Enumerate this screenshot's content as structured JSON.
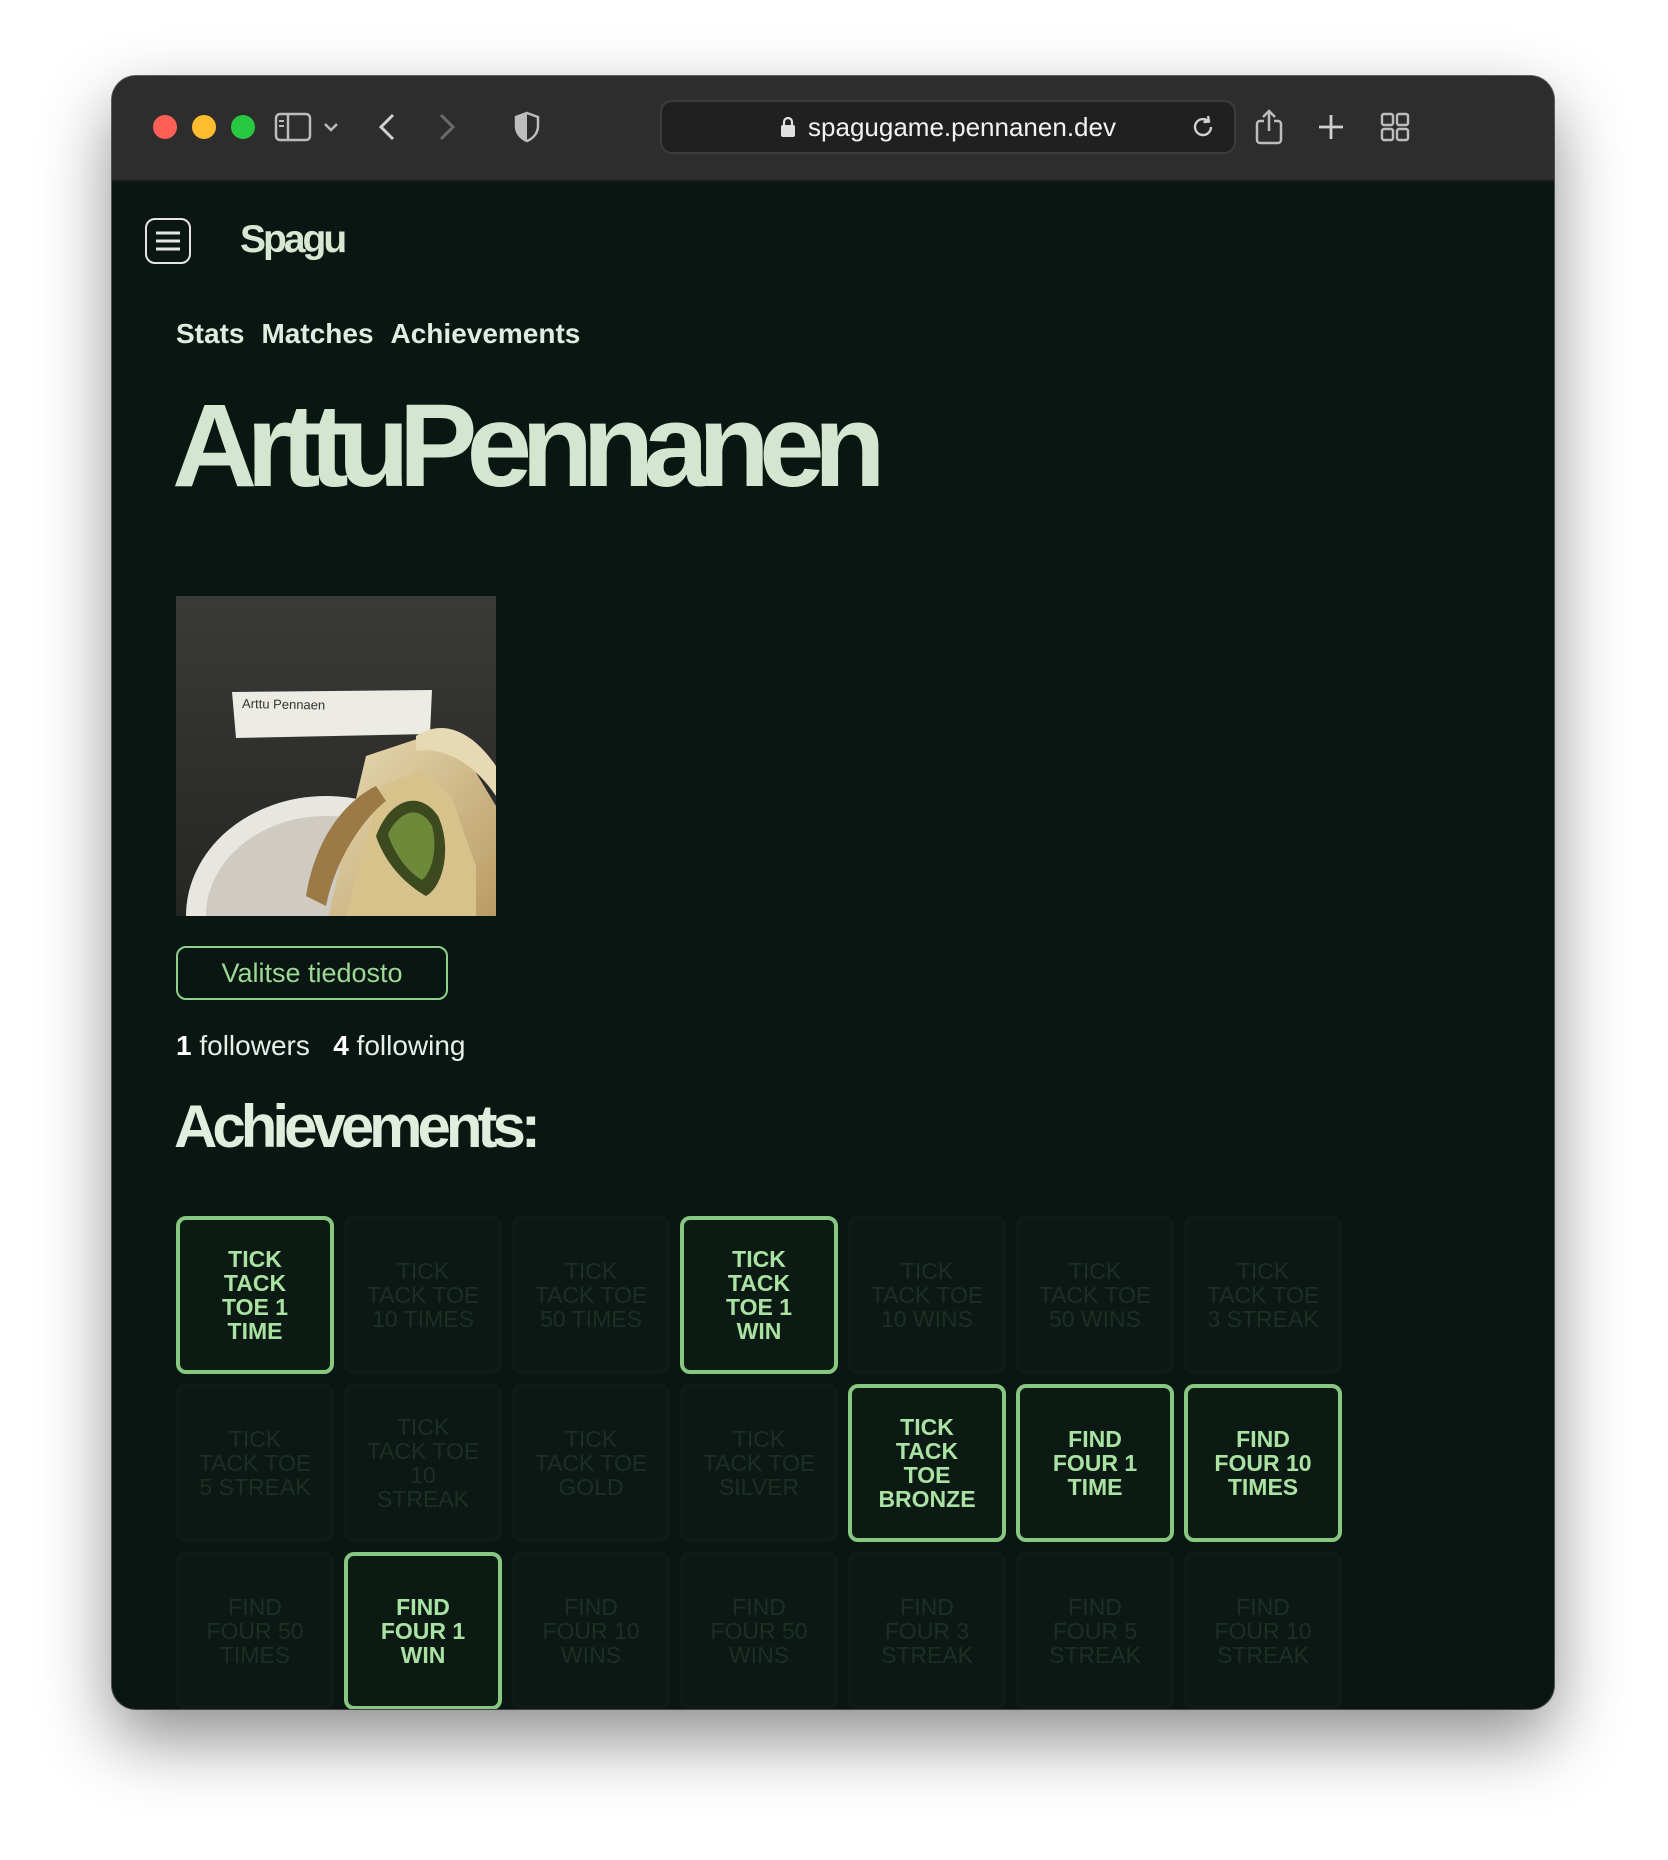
{
  "browser": {
    "url": "spagugame.pennanen.dev"
  },
  "app": {
    "logo": "Spagu"
  },
  "nav": {
    "items": [
      "Stats",
      "Matches",
      "Achievements"
    ]
  },
  "profile": {
    "name": "ArttuPennanen",
    "photo_label": "Arttu Pennaen",
    "file_button": "Valitse tiedosto",
    "followers_count": "1",
    "followers_label": "followers",
    "following_count": "4",
    "following_label": "following"
  },
  "achievements": {
    "title": "Achievements:",
    "items": [
      {
        "label": "TICK TACK TOE 1 TIME",
        "unlocked": true
      },
      {
        "label": "TICK TACK TOE 10 TIMES",
        "unlocked": false
      },
      {
        "label": "TICK TACK TOE 50 TIMES",
        "unlocked": false
      },
      {
        "label": "TICK TACK TOE 1 WIN",
        "unlocked": true
      },
      {
        "label": "TICK TACK TOE 10 WINS",
        "unlocked": false
      },
      {
        "label": "TICK TACK TOE 50 WINS",
        "unlocked": false
      },
      {
        "label": "TICK TACK TOE 3 STREAK",
        "unlocked": false
      },
      {
        "label": "TICK TACK TOE 5 STREAK",
        "unlocked": false
      },
      {
        "label": "TICK TACK TOE 10 STREAK",
        "unlocked": false
      },
      {
        "label": "TICK TACK TOE GOLD",
        "unlocked": false
      },
      {
        "label": "TICK TACK TOE SILVER",
        "unlocked": false
      },
      {
        "label": "TICK TACK TOE BRONZE",
        "unlocked": true
      },
      {
        "label": "FIND FOUR 1 TIME",
        "unlocked": true
      },
      {
        "label": "FIND FOUR 10 TIMES",
        "unlocked": true
      },
      {
        "label": "FIND FOUR 50 TIMES",
        "unlocked": false
      },
      {
        "label": "FIND FOUR 1 WIN",
        "unlocked": true
      },
      {
        "label": "FIND FOUR 10 WINS",
        "unlocked": false
      },
      {
        "label": "FIND FOUR 50 WINS",
        "unlocked": false
      },
      {
        "label": "FIND FOUR 3 STREAK",
        "unlocked": false
      },
      {
        "label": "FIND FOUR 5 STREAK",
        "unlocked": false
      },
      {
        "label": "FIND FOUR 10 STREAK",
        "unlocked": false
      }
    ]
  },
  "colors": {
    "background": "#0a1611",
    "accent": "#86c881",
    "text": "#d3e6cf"
  },
  "icons": [
    "sidebar-icon",
    "chevron-down-icon",
    "back-icon",
    "forward-icon",
    "shield-icon",
    "lock-icon",
    "reload-icon",
    "share-icon",
    "plus-icon",
    "tabs-grid-icon",
    "hamburger-menu-icon"
  ]
}
